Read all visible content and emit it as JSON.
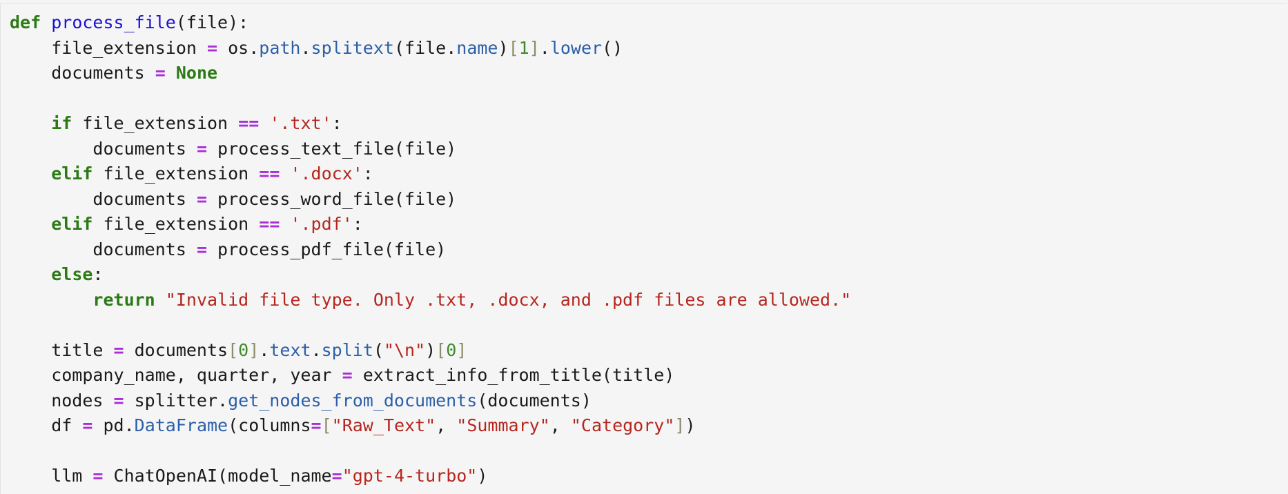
{
  "code_lines": [
    [
      {
        "t": "def",
        "c": "k"
      },
      {
        "t": " "
      },
      {
        "t": "process_file",
        "c": "fn"
      },
      {
        "t": "(file):"
      }
    ],
    [
      {
        "t": "    file_extension "
      },
      {
        "t": "=",
        "c": "o"
      },
      {
        "t": " os."
      },
      {
        "t": "path",
        "c": "a"
      },
      {
        "t": "."
      },
      {
        "t": "splitext",
        "c": "a"
      },
      {
        "t": "(file."
      },
      {
        "t": "name",
        "c": "a"
      },
      {
        "t": ")"
      },
      {
        "t": "[",
        "c": "b"
      },
      {
        "t": "1",
        "c": "n"
      },
      {
        "t": "]",
        "c": "b"
      },
      {
        "t": "."
      },
      {
        "t": "lower",
        "c": "a"
      },
      {
        "t": "()"
      }
    ],
    [
      {
        "t": "    documents "
      },
      {
        "t": "=",
        "c": "o"
      },
      {
        "t": " "
      },
      {
        "t": "None",
        "c": "k"
      }
    ],
    [],
    [
      {
        "t": "    "
      },
      {
        "t": "if",
        "c": "k"
      },
      {
        "t": " file_extension "
      },
      {
        "t": "==",
        "c": "o"
      },
      {
        "t": " "
      },
      {
        "t": "'.txt'",
        "c": "s"
      },
      {
        "t": ":"
      }
    ],
    [
      {
        "t": "        documents "
      },
      {
        "t": "=",
        "c": "o"
      },
      {
        "t": " process_text_file(file)"
      }
    ],
    [
      {
        "t": "    "
      },
      {
        "t": "elif",
        "c": "k"
      },
      {
        "t": " file_extension "
      },
      {
        "t": "==",
        "c": "o"
      },
      {
        "t": " "
      },
      {
        "t": "'.docx'",
        "c": "s"
      },
      {
        "t": ":"
      }
    ],
    [
      {
        "t": "        documents "
      },
      {
        "t": "=",
        "c": "o"
      },
      {
        "t": " process_word_file(file)"
      }
    ],
    [
      {
        "t": "    "
      },
      {
        "t": "elif",
        "c": "k"
      },
      {
        "t": " file_extension "
      },
      {
        "t": "==",
        "c": "o"
      },
      {
        "t": " "
      },
      {
        "t": "'.pdf'",
        "c": "s"
      },
      {
        "t": ":"
      }
    ],
    [
      {
        "t": "        documents "
      },
      {
        "t": "=",
        "c": "o"
      },
      {
        "t": " process_pdf_file(file)"
      }
    ],
    [
      {
        "t": "    "
      },
      {
        "t": "else",
        "c": "k"
      },
      {
        "t": ":"
      }
    ],
    [
      {
        "t": "        "
      },
      {
        "t": "return",
        "c": "k"
      },
      {
        "t": " "
      },
      {
        "t": "\"Invalid file type. Only .txt, .docx, and .pdf files are allowed.\"",
        "c": "s"
      }
    ],
    [],
    [
      {
        "t": "    title "
      },
      {
        "t": "=",
        "c": "o"
      },
      {
        "t": " documents"
      },
      {
        "t": "[",
        "c": "b"
      },
      {
        "t": "0",
        "c": "n"
      },
      {
        "t": "]",
        "c": "b"
      },
      {
        "t": "."
      },
      {
        "t": "text",
        "c": "a"
      },
      {
        "t": "."
      },
      {
        "t": "split",
        "c": "a"
      },
      {
        "t": "("
      },
      {
        "t": "\"\\n\"",
        "c": "s"
      },
      {
        "t": ")"
      },
      {
        "t": "[",
        "c": "b"
      },
      {
        "t": "0",
        "c": "n"
      },
      {
        "t": "]",
        "c": "b"
      }
    ],
    [
      {
        "t": "    company_name, quarter, year "
      },
      {
        "t": "=",
        "c": "o"
      },
      {
        "t": " extract_info_from_title(title)"
      }
    ],
    [
      {
        "t": "    nodes "
      },
      {
        "t": "=",
        "c": "o"
      },
      {
        "t": " splitter."
      },
      {
        "t": "get_nodes_from_documents",
        "c": "a"
      },
      {
        "t": "(documents)"
      }
    ],
    [
      {
        "t": "    df "
      },
      {
        "t": "=",
        "c": "o"
      },
      {
        "t": " pd."
      },
      {
        "t": "DataFrame",
        "c": "a"
      },
      {
        "t": "(columns"
      },
      {
        "t": "=",
        "c": "o"
      },
      {
        "t": "[",
        "c": "b"
      },
      {
        "t": "\"Raw_Text\"",
        "c": "s"
      },
      {
        "t": ", "
      },
      {
        "t": "\"Summary\"",
        "c": "s"
      },
      {
        "t": ", "
      },
      {
        "t": "\"Category\"",
        "c": "s"
      },
      {
        "t": "]",
        "c": "b"
      },
      {
        "t": ")"
      }
    ],
    [],
    [
      {
        "t": "    llm "
      },
      {
        "t": "=",
        "c": "o"
      },
      {
        "t": " ChatOpenAI(model_name"
      },
      {
        "t": "=",
        "c": "o"
      },
      {
        "t": "\"gpt-4-turbo\"",
        "c": "s"
      },
      {
        "t": ")"
      }
    ]
  ]
}
